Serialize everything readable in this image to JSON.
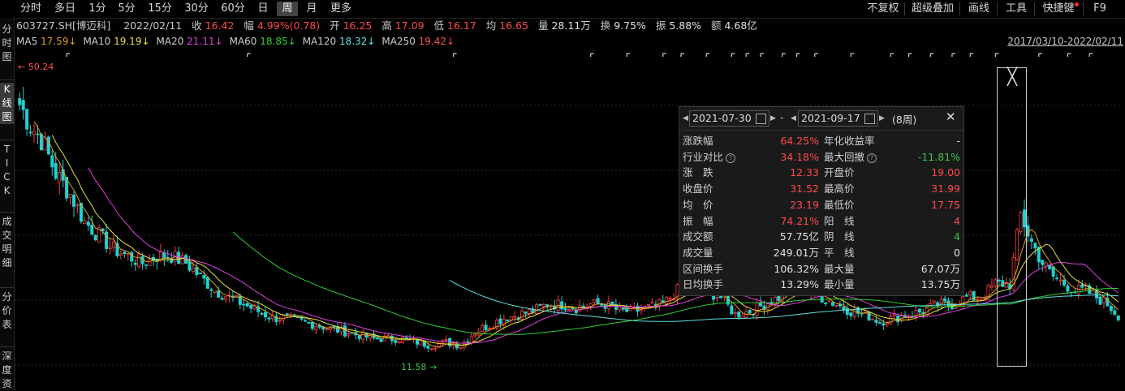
{
  "toolbar": {
    "periods": [
      "分时",
      "多日",
      "1分",
      "5分",
      "15分",
      "30分",
      "60分",
      "日",
      "周",
      "月",
      "更多"
    ],
    "active_period": "周",
    "right_items": [
      "不复权",
      "超级叠加",
      "画线",
      "工具",
      "快捷键",
      "F9"
    ]
  },
  "sidebar": {
    "items": [
      "分时图",
      "K线图",
      "TICK",
      "成交明细",
      "分价表",
      "深度资"
    ],
    "active": "K线图"
  },
  "info": {
    "code": "603727.SH[博迈科]",
    "date": "2022/02/11",
    "close_label": "收",
    "close": "16.42",
    "change_label": "幅",
    "change": "4.99%(0.78)",
    "open_label": "开",
    "open": "16.25",
    "high_label": "高",
    "high": "17.09",
    "low_label": "低",
    "low": "16.17",
    "avg_label": "均",
    "avg": "16.65",
    "vol_label": "量",
    "vol": "28.11万",
    "turnover_label": "换",
    "turnover": "9.75%",
    "amp_label": "振",
    "amp": "5.88%",
    "amount_label": "额",
    "amount": "4.68亿"
  },
  "ma": [
    {
      "label": "MA5",
      "value": "17.59",
      "arrow": "↓",
      "color": "#e0a020"
    },
    {
      "label": "MA10",
      "value": "19.19",
      "arrow": "↓",
      "color": "#e8e040"
    },
    {
      "label": "MA20",
      "value": "21.11",
      "arrow": "↓",
      "color": "#e040e0"
    },
    {
      "label": "MA60",
      "value": "18.85",
      "arrow": "↓",
      "color": "#30d030"
    },
    {
      "label": "MA120",
      "value": "18.32",
      "arrow": "↓",
      "color": "#60e0e0"
    },
    {
      "label": "MA250",
      "value": "19.42",
      "arrow": "↓",
      "color": "#ff5050"
    }
  ],
  "date_range": "2017/03/10-2022/02/11",
  "annotations": {
    "high": "50.24",
    "low": "11.58"
  },
  "panel": {
    "start_date": "2021-07-30",
    "end_date": "2021-09-17",
    "dash": "-",
    "weeks": "(8周)",
    "left_rows": [
      {
        "label": "涨跌幅",
        "value": "64.25%",
        "color": "#ff4a4a",
        "help": false
      },
      {
        "label": "行业对比",
        "value": "34.18%",
        "color": "#ff4a4a",
        "help": true
      },
      {
        "label": "涨　跌",
        "value": "12.33",
        "color": "#ff4a4a",
        "help": false
      },
      {
        "label": "收盘价",
        "value": "31.52",
        "color": "#ff4a4a",
        "help": false
      },
      {
        "label": "均　价",
        "value": "23.19",
        "color": "#ff4a4a",
        "help": false
      },
      {
        "label": "振　幅",
        "value": "74.21%",
        "color": "#ff4a4a",
        "help": false
      },
      {
        "label": "成交额",
        "value": "57.75亿",
        "color": "#e0e0e0",
        "help": false
      },
      {
        "label": "成交量",
        "value": "249.01万",
        "color": "#e0e0e0",
        "help": false
      },
      {
        "label": "区间换手",
        "value": "106.32%",
        "color": "#e0e0e0",
        "help": false
      },
      {
        "label": "日均换手",
        "value": "13.29%",
        "color": "#e0e0e0",
        "help": false
      }
    ],
    "right_rows": [
      {
        "label": "年化收益率",
        "value": "-",
        "color": "#e0e0e0",
        "help": false
      },
      {
        "label": "最大回撤",
        "value": "-11.81%",
        "color": "#3ec24f",
        "help": true
      },
      {
        "label": "开盘价",
        "value": "19.00",
        "color": "#ff4a4a",
        "help": false
      },
      {
        "label": "最高价",
        "value": "31.99",
        "color": "#ff4a4a",
        "help": false
      },
      {
        "label": "最低价",
        "value": "17.75",
        "color": "#ff4a4a",
        "help": false
      },
      {
        "label": "阳　线",
        "value": "4",
        "color": "#ff4a4a",
        "help": false
      },
      {
        "label": "阴　线",
        "value": "4",
        "color": "#3ec24f",
        "help": false
      },
      {
        "label": "平　线",
        "value": "0",
        "color": "#e0e0e0",
        "help": false
      },
      {
        "label": "最大量",
        "value": "67.07万",
        "color": "#e0e0e0",
        "help": false
      },
      {
        "label": "最小量",
        "value": "13.75万",
        "color": "#e0e0e0",
        "help": false
      }
    ]
  },
  "chart_data": {
    "type": "candlestick",
    "y_range": [
      8,
      53
    ],
    "series_names": [
      "MA5",
      "MA10",
      "MA20",
      "MA60",
      "MA120",
      "MA250"
    ],
    "price_anchors": [
      [
        0,
        47
      ],
      [
        3,
        44
      ],
      [
        6,
        42
      ],
      [
        10,
        37
      ],
      [
        14,
        34
      ],
      [
        18,
        30
      ],
      [
        22,
        28
      ],
      [
        26,
        26
      ],
      [
        30,
        25
      ],
      [
        34,
        24
      ],
      [
        38,
        25
      ],
      [
        42,
        25
      ],
      [
        46,
        24
      ],
      [
        50,
        22
      ],
      [
        54,
        20
      ],
      [
        58,
        19
      ],
      [
        62,
        18
      ],
      [
        66,
        17
      ],
      [
        70,
        16
      ],
      [
        74,
        16
      ],
      [
        78,
        15.5
      ],
      [
        82,
        15
      ],
      [
        86,
        14.5
      ],
      [
        90,
        14
      ],
      [
        94,
        13.5
      ],
      [
        98,
        13
      ],
      [
        102,
        13
      ],
      [
        106,
        13
      ],
      [
        110,
        12.5
      ],
      [
        114,
        12
      ],
      [
        118,
        12.5
      ],
      [
        122,
        12
      ],
      [
        126,
        14
      ],
      [
        130,
        15
      ],
      [
        134,
        16
      ],
      [
        138,
        16.5
      ],
      [
        142,
        17
      ],
      [
        146,
        18
      ],
      [
        150,
        18
      ],
      [
        154,
        17.5
      ],
      [
        158,
        18
      ],
      [
        162,
        18
      ],
      [
        166,
        17
      ],
      [
        170,
        17
      ],
      [
        174,
        17.5
      ],
      [
        178,
        18
      ],
      [
        182,
        20
      ],
      [
        186,
        21
      ],
      [
        190,
        20
      ],
      [
        194,
        19
      ],
      [
        198,
        16.5
      ],
      [
        202,
        17
      ],
      [
        206,
        18
      ],
      [
        210,
        19
      ],
      [
        214,
        21
      ],
      [
        218,
        20
      ],
      [
        222,
        19
      ],
      [
        226,
        18
      ],
      [
        230,
        17
      ],
      [
        234,
        16.5
      ],
      [
        238,
        15.5
      ],
      [
        242,
        16
      ],
      [
        246,
        16.5
      ],
      [
        250,
        17
      ],
      [
        254,
        18
      ],
      [
        258,
        18
      ],
      [
        262,
        19
      ],
      [
        266,
        19
      ],
      [
        270,
        21
      ],
      [
        274,
        21
      ],
      [
        277,
        31
      ],
      [
        280,
        27
      ],
      [
        283,
        24
      ],
      [
        286,
        22
      ],
      [
        289,
        21
      ],
      [
        292,
        20
      ],
      [
        295,
        20
      ],
      [
        298,
        19
      ],
      [
        301,
        18
      ],
      [
        304,
        16.4
      ]
    ],
    "bars": 305
  }
}
